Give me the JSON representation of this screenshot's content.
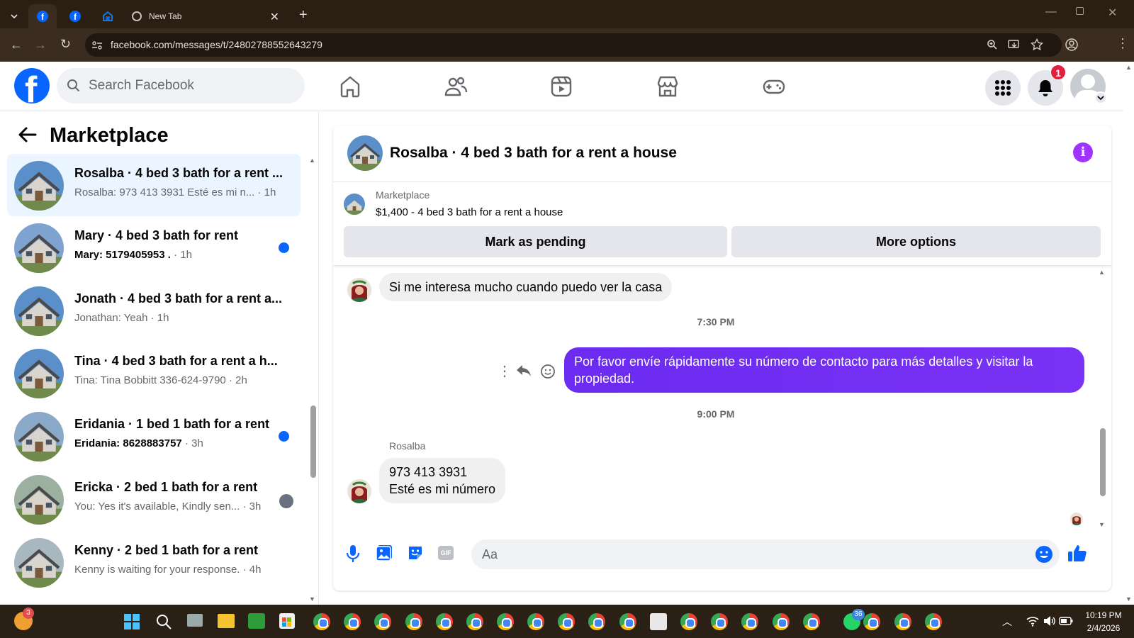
{
  "browser": {
    "tabs": [
      {
        "label": ""
      },
      {
        "label": ""
      },
      {
        "label": ""
      },
      {
        "label": "New Tab"
      }
    ],
    "url": "facebook.com/messages/t/24802788552643279"
  },
  "header": {
    "search_placeholder": "Search Facebook",
    "notif_count": "1"
  },
  "sidebar": {
    "title": "Marketplace",
    "conversations": [
      {
        "title": "Rosalba · 4 bed 3 bath for a rent ...",
        "preview": "Rosalba: 973 413 3931 Esté es mi n...",
        "time": " · 1h",
        "unread": false,
        "selected": true
      },
      {
        "title": "Mary · 4 bed 3 bath for rent",
        "preview": "Mary: 5179405953 .",
        "time": " · 1h",
        "unread": true
      },
      {
        "title": "Jonath · 4 bed 3 bath for a rent a...",
        "preview": "Jonathan: Yeah",
        "time": " · 1h",
        "unread": false
      },
      {
        "title": "Tina · 4 bed 3 bath for a rent a h...",
        "preview": "Tina: Tina Bobbitt 336-624-9790",
        "time": " · 2h",
        "unread": false
      },
      {
        "title": "Eridania · 1 bed 1 bath for a rent",
        "preview": "Eridania: 8628883757",
        "time": " · 3h",
        "unread": true
      },
      {
        "title": "Ericka · 2 bed 1 bath for a rent",
        "preview": "You: Yes it's available, Kindly sen...",
        "time": " · 3h",
        "unread": false
      },
      {
        "title": "Kenny · 2 bed 1 bath for a rent",
        "preview": "Kenny is waiting for your response.",
        "time": " · 4h",
        "unread": false
      }
    ]
  },
  "chat": {
    "title": "Rosalba · 4 bed 3 bath for a rent a house",
    "listing_source": "Marketplace",
    "listing_text": "$1,400 - 4 bed 3 bath for a rent a house",
    "mark_pending": "Mark as pending",
    "more_options": "More options",
    "messages": [
      {
        "text": "Si me interesa mucho cuando puedo ver la casa"
      },
      {
        "text": "Por favor envíe rápidamente su número de contacto para más detalles y visitar la propiedad."
      },
      {
        "line1": "973 413 3931",
        "line2": "Esté es mi número"
      }
    ],
    "ts1": "7:30 PM",
    "ts2": "9:00 PM",
    "sender": "Rosalba",
    "composer_placeholder": "Aa"
  },
  "taskbar": {
    "time": "10:19 PM",
    "date": "2/4/2026",
    "badge_weather": "3",
    "badge_whatsapp": "36"
  }
}
